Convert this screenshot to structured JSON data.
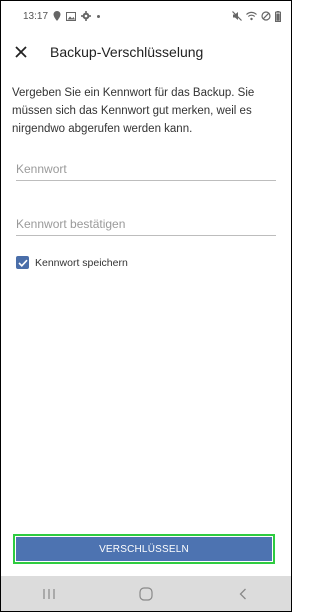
{
  "status_bar": {
    "time": "13:17",
    "left_icons": [
      "location-icon",
      "image-icon",
      "gear-icon",
      "dot-icon"
    ],
    "right_icons": [
      "mute-icon",
      "wifi-icon",
      "dnd-icon",
      "battery-icon"
    ]
  },
  "app_bar": {
    "close_icon": "close-icon",
    "title": "Backup-Verschlüsselung"
  },
  "description": "Vergeben Sie ein Kennwort für das Backup. Sie müssen sich das Kennwort gut merken, weil es nirgendwo abgerufen werden kann.",
  "form": {
    "password_placeholder": "Kennwort",
    "password_value": "",
    "confirm_placeholder": "Kennwort bestätigen",
    "confirm_value": "",
    "save_checkbox_label": "Kennwort speichern",
    "save_checkbox_checked": true
  },
  "actions": {
    "encrypt_button_label": "VERSCHLÜSSELN"
  },
  "nav_bar": {
    "icons": [
      "recents-icon",
      "home-icon",
      "back-icon"
    ]
  },
  "colors": {
    "accent": "#4d73b1",
    "checkbox": "#4a6ea9",
    "focus_outline": "#2ecc40",
    "nav_background": "#dcdcdc"
  }
}
